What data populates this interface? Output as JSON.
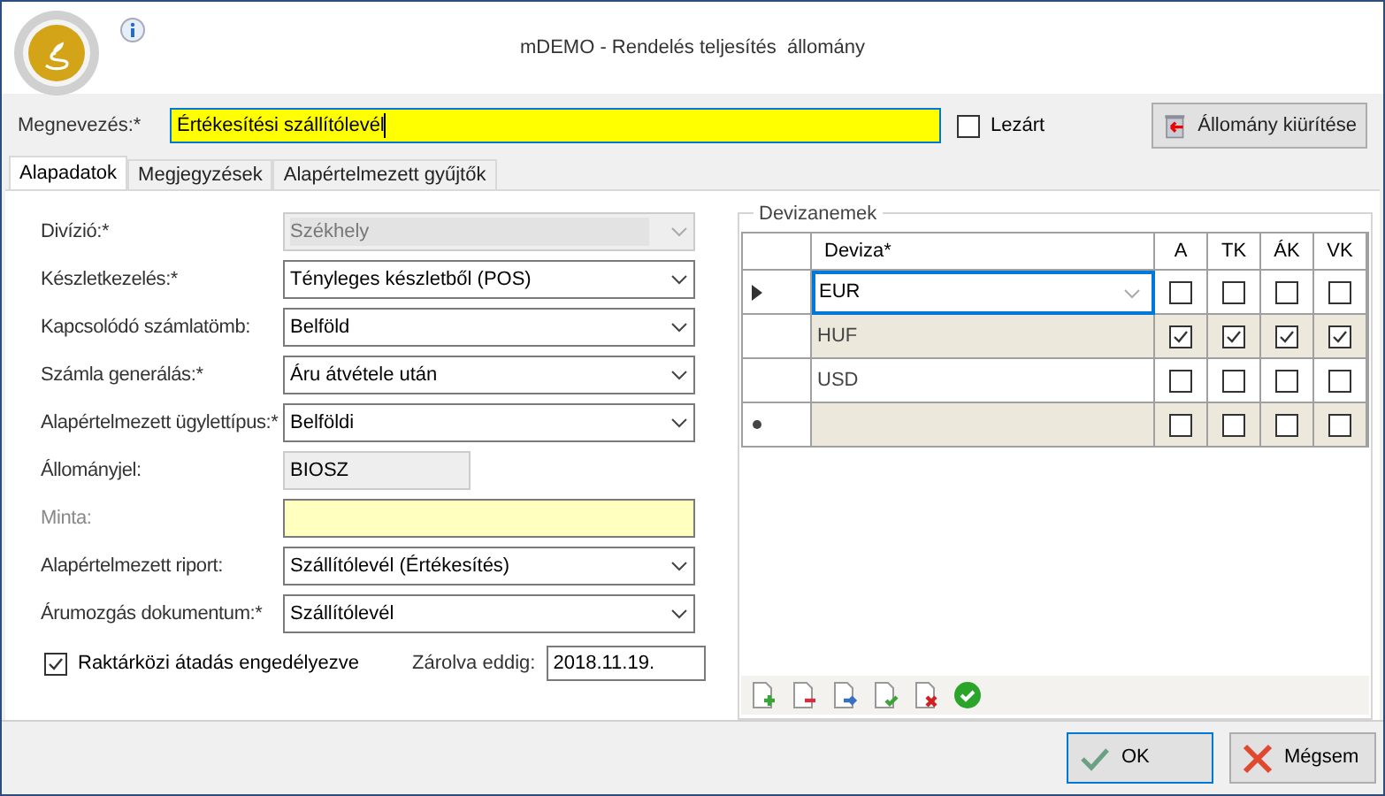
{
  "window": {
    "title": "mDEMO - Rendelés teljesítés  állomány"
  },
  "name_field": {
    "label": "Megnevezés:*",
    "value": "Értékesítési szállítólevél"
  },
  "closed_checkbox": {
    "label": "Lezárt",
    "checked": false
  },
  "clear_button": {
    "label": "Állomány kiürítése"
  },
  "tabs": [
    {
      "label": "Alapadatok",
      "selected": true
    },
    {
      "label": "Megjegyzések",
      "selected": false
    },
    {
      "label": "Alapértelmezett gyűjtők",
      "selected": false
    }
  ],
  "fields": [
    {
      "label": "Divízió:*",
      "kind": "select",
      "value": "Székhely",
      "disabled": true,
      "highlighted": false,
      "label_muted": false
    },
    {
      "label": "Készletkezelés:*",
      "kind": "select",
      "value": "Tényleges készletből (POS)",
      "disabled": false,
      "highlighted": false,
      "label_muted": false
    },
    {
      "label": "Kapcsolódó számlatömb:",
      "kind": "select",
      "value": "Belföld",
      "disabled": false,
      "highlighted": false,
      "label_muted": false
    },
    {
      "label": "Számla generálás:*",
      "kind": "select",
      "value": "Áru átvétele után",
      "disabled": false,
      "highlighted": false,
      "label_muted": false
    },
    {
      "label": "Alapértelmezett ügylettípus:*",
      "kind": "select",
      "value": "Belföldi",
      "disabled": false,
      "highlighted": false,
      "label_muted": false
    },
    {
      "label": "Állományjel:",
      "kind": "text",
      "value": "BIOSZ",
      "disabled": true,
      "highlighted": false,
      "label_muted": false
    },
    {
      "label": "Minta:",
      "kind": "text",
      "disabled": false,
      "highlighted": true,
      "label_muted": true
    },
    {
      "label": "Alapértelmezett riport:",
      "kind": "select",
      "value": "Szállítólevél (Értékesítés)",
      "disabled": false,
      "highlighted": false,
      "label_muted": false
    },
    {
      "label": "Árumozgás dokumentum:*",
      "kind": "select",
      "value": "Szállítólevél",
      "disabled": false,
      "highlighted": false,
      "label_muted": false
    }
  ],
  "transfer_checkbox": {
    "label": "Raktárközi átadás engedélyezve",
    "checked": true
  },
  "locked_until": {
    "label": "Zárolva eddig:",
    "value": "2018.11.19."
  },
  "currencies": {
    "title": "Devizanemek",
    "columns": [
      "Deviza*",
      "A",
      "TK",
      "ÁK",
      "VK"
    ],
    "rows": [
      {
        "kind": "data",
        "selected": true,
        "currency": "EUR",
        "checks": [
          false,
          false,
          false,
          false
        ]
      },
      {
        "kind": "data",
        "selected": false,
        "currency": "HUF",
        "checks": [
          true,
          true,
          true,
          true
        ]
      },
      {
        "kind": "data",
        "selected": false,
        "currency": "USD",
        "checks": [
          false,
          false,
          false,
          false
        ]
      },
      {
        "kind": "new",
        "selected": false,
        "checks": [
          false,
          false,
          false,
          false
        ]
      }
    ]
  },
  "buttons": [
    {
      "label": "OK",
      "kind": "ok"
    },
    {
      "label": "Mégsem",
      "kind": "cancel"
    }
  ]
}
